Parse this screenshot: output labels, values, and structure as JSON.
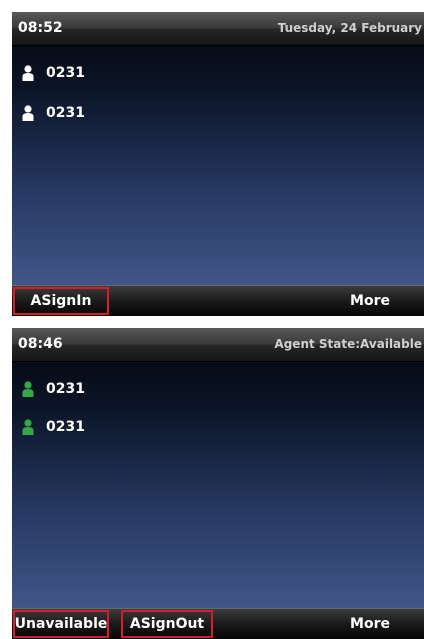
{
  "screen_signed_out": {
    "time": "08:52",
    "status_text": "Tuesday, 24 February",
    "lines": [
      {
        "label": "0231",
        "icon": "person-icon",
        "icon_color": "#ffffff"
      },
      {
        "label": "0231",
        "icon": "person-icon",
        "icon_color": "#ffffff"
      }
    ],
    "softkeys": {
      "asignin": "ASignIn",
      "more": "More"
    }
  },
  "screen_signed_in": {
    "time": "08:46",
    "status_text": "Agent State:Available",
    "lines": [
      {
        "label": "0231",
        "icon": "person-icon",
        "icon_color": "#35a84a"
      },
      {
        "label": "0231",
        "icon": "person-icon",
        "icon_color": "#35a84a"
      }
    ],
    "softkeys": {
      "unavailable": "Unavailable",
      "asignout": "ASignOut",
      "more": "More"
    }
  },
  "colors": {
    "highlight_box": "#d41e2c",
    "agent_available": "#35a84a"
  }
}
